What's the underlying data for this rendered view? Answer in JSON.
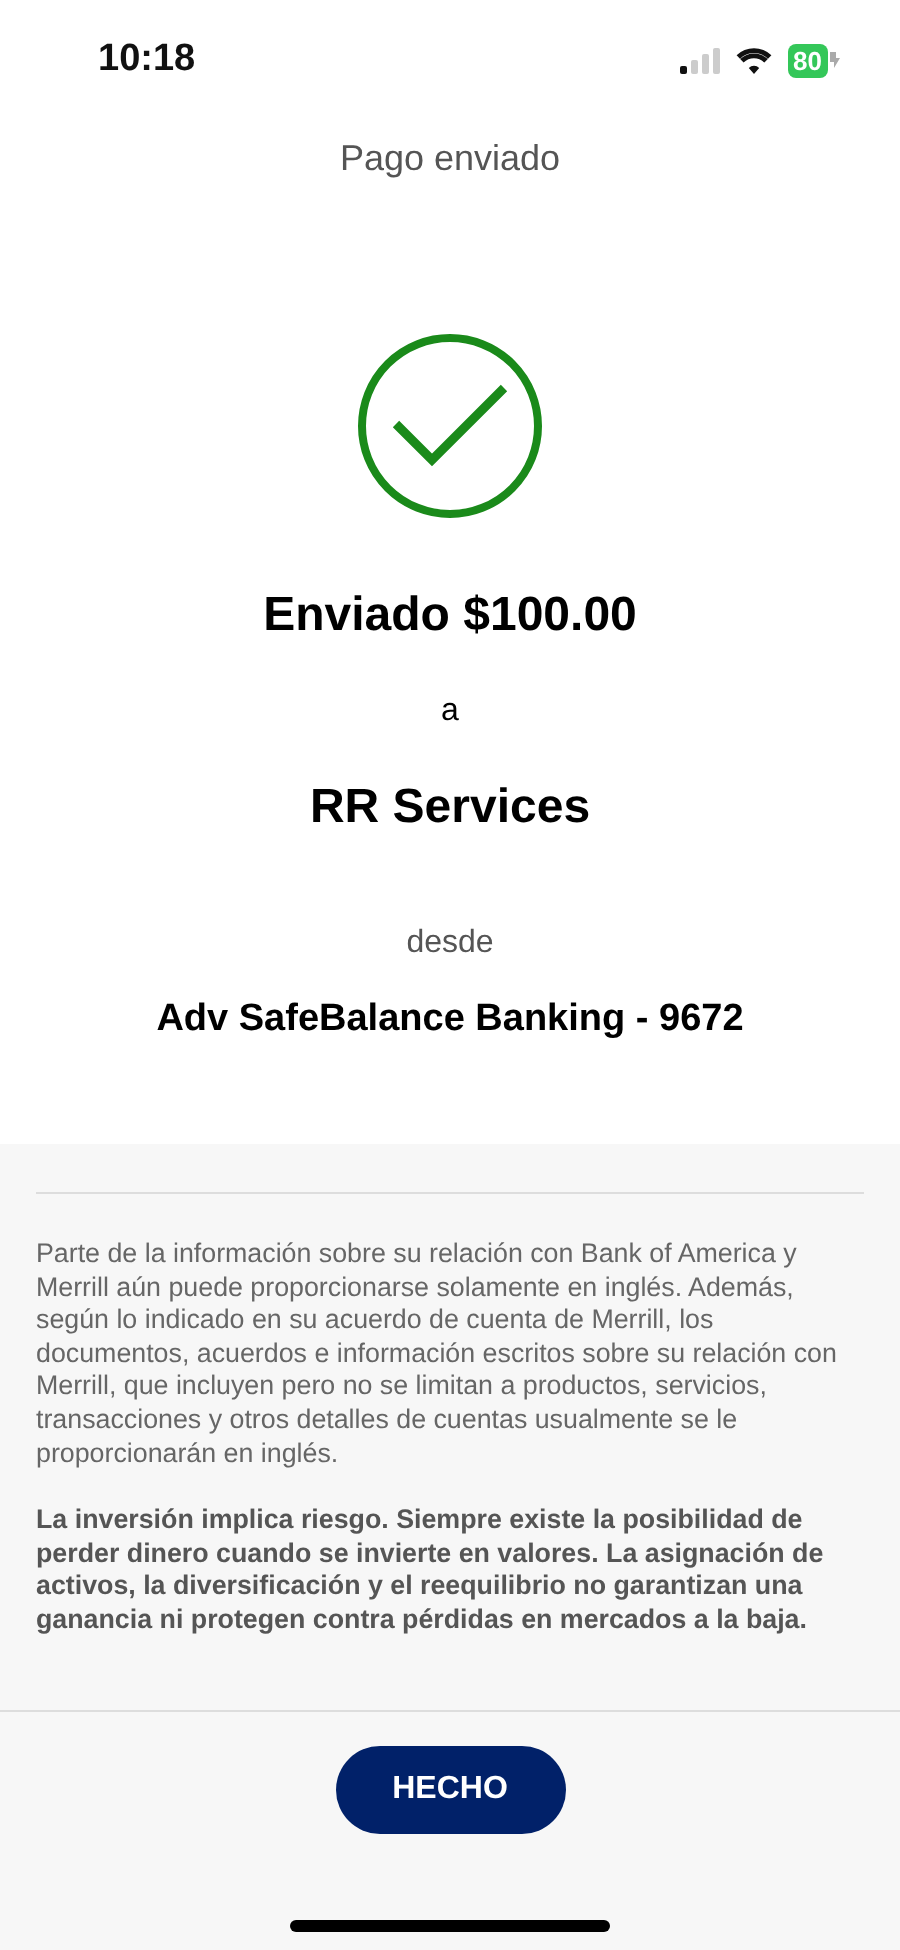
{
  "status_bar": {
    "time": "10:18",
    "battery": "80"
  },
  "header": {
    "title": "Pago enviado"
  },
  "confirmation": {
    "amount_line": "Enviado $100.00",
    "connector": "a",
    "payee": "RR Services",
    "from_label": "desde",
    "account": "Adv SafeBalance Banking - 9672"
  },
  "disclaimers": [
    {
      "text": "Parte de la información sobre su relación con Bank of America y Merrill aún puede proporcionarse solamente en inglés. Además, según lo indicado en su acuerdo de cuenta de Merrill, los documentos, acuerdos e información escritos sobre su relación con Merrill, que incluyen pero no se limitan a productos, servicios, transacciones y otros detalles de cuentas usualmente se le proporcionarán en inglés.",
      "kind": "plain"
    },
    {
      "text": "La inversión implica riesgo. Siempre existe la posibilidad de perder dinero cuando se invierte en valores. La asignación de activos, la diversificación y el reequilibrio no garantizan una ganancia ni protegen contra pérdidas en mercados a la baja.",
      "kind": "emphasis"
    }
  ],
  "buttons": [
    "HECHO"
  ]
}
